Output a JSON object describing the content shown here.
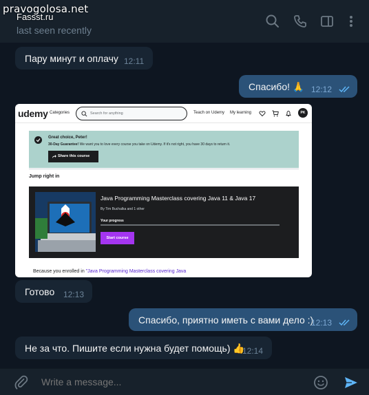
{
  "watermark": "pravogolosa.net",
  "chat": {
    "name": "Fassst.ru",
    "status": "last seen recently"
  },
  "header_icons": [
    "search-icon",
    "phone-icon",
    "sidebar-toggle-icon",
    "more-vert-icon"
  ],
  "messages": [
    {
      "dir": "in",
      "text": "Пару минут и оплачу",
      "time": "12:11"
    },
    {
      "dir": "out",
      "text": "Спасибо! 🙏",
      "time": "12:12"
    },
    {
      "dir": "in",
      "type": "image"
    },
    {
      "dir": "in",
      "text": "Готово",
      "time": "12:13"
    },
    {
      "dir": "out",
      "text": "Спасибо, приятно иметь с вами дело :)",
      "time": "12:13"
    },
    {
      "dir": "in",
      "text": "Не за что. Пишите если нужна будет помощь) 👍",
      "time": "12:14"
    }
  ],
  "screenshot": {
    "logo": "udemy",
    "nav_categories": "Categories",
    "search_placeholder": "Search for anything",
    "nav_teach": "Teach on Udemy",
    "nav_learning": "My learning",
    "avatar_initials": "PK",
    "banner_title": "Great choice, Peter!",
    "banner_guarantee_bold": "30-Day Guarantee!",
    "banner_guarantee_text": " We want you to love every course you take on Udemy. If it's not right, you have 30 days to return it.",
    "share_button": "Share this course",
    "section_title": "Jump right in",
    "course_title": "Java Programming Masterclass covering Java 11 & Java 17",
    "course_author": "By Tim Buchalka and 1 other",
    "progress_label": "Your progress",
    "progress": 0,
    "start_button": "Start course",
    "because_prefix": "Because you enrolled in ",
    "because_course": "\"Java Programming Masterclass covering Java"
  },
  "composer": {
    "placeholder": "Write a message..."
  },
  "colors": {
    "background": "#0e1621",
    "header": "#17212b",
    "incoming": "#182533",
    "outgoing": "#2b5278",
    "accent": "#5eb5f7",
    "udemy_purple": "#a435f0"
  }
}
